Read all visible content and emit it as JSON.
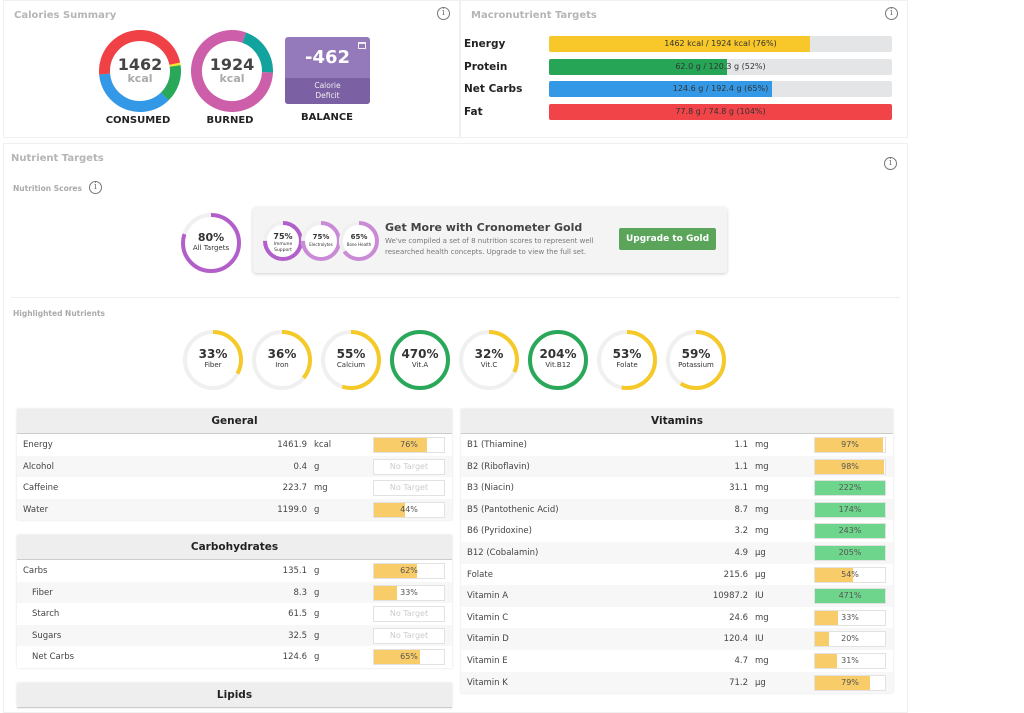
{
  "colors": {
    "yellow": "#f5c928",
    "green": "#2aa85a",
    "blue": "#3399e6",
    "red": "#ef4146",
    "purple": "#b35fc9",
    "magenta": "#cd5eaa",
    "teal": "#12a39f",
    "bar_yellow": "#f8cc68",
    "bar_green": "#6dd68c",
    "track": "#eeeeee"
  },
  "calories": {
    "title": "Calories Summary",
    "info_icon": "info-icon",
    "consumed": {
      "value": "1462",
      "unit": "kcal",
      "label": "CONSUMED",
      "segments": [
        {
          "color": "#ef4146",
          "fraction": 0.48
        },
        {
          "color": "#f5e428",
          "fraction": 0.01
        },
        {
          "color": "#2aa85a",
          "fraction": 0.15
        },
        {
          "color": "#3399e6",
          "fraction": 0.36
        }
      ]
    },
    "burned": {
      "value": "1924",
      "unit": "kcal",
      "label": "BURNED",
      "segments": [
        {
          "color": "#12a39f",
          "fraction": 0.2
        },
        {
          "color": "#cd5eaa",
          "fraction": 0.8
        }
      ]
    },
    "balance": {
      "value": "-462",
      "sub1": "Calorie",
      "sub2": "Deficit",
      "label": "BALANCE",
      "icon": "calendar-icon"
    }
  },
  "macros": {
    "title": "Macronutrient Targets",
    "items": [
      {
        "label": "Energy",
        "text": "1462 kcal / 1924 kcal (76%)",
        "percent": 76,
        "color": "#f8c72a"
      },
      {
        "label": "Protein",
        "text": "62.0 g / 120.3 g (52%)",
        "percent": 52,
        "color": "#26a556"
      },
      {
        "label": "Net Carbs",
        "text": "124.6 g / 192.4 g (65%)",
        "percent": 65,
        "color": "#3399e6"
      },
      {
        "label": "Fat",
        "text": "77.8 g / 74.8 g (104%)",
        "percent": 104,
        "color": "#f04449"
      }
    ]
  },
  "nutrient_targets": {
    "title": "Nutrient Targets",
    "scores_label": "Nutrition Scores",
    "all_targets": {
      "value": "80%",
      "label": "All Targets",
      "percent": 80
    },
    "promo": {
      "scores": [
        {
          "value": "75%",
          "label": "Immune Support",
          "percent": 75
        },
        {
          "value": "75%",
          "label": "Electrolytes",
          "percent": 75
        },
        {
          "value": "65%",
          "label": "Bone Health",
          "percent": 65
        }
      ],
      "title": "Get More with Cronometer Gold",
      "text": "We've compiled a set of 8 nutrition scores to represent well researched health concepts. Upgrade to view the full set.",
      "button": "Upgrade to Gold"
    },
    "highlighted_label": "Highlighted Nutrients",
    "highlighted": [
      {
        "value": "33%",
        "label": "Fiber",
        "percent": 33
      },
      {
        "value": "36%",
        "label": "Iron",
        "percent": 36
      },
      {
        "value": "55%",
        "label": "Calcium",
        "percent": 55
      },
      {
        "value": "470%",
        "label": "Vit.A",
        "percent": 470
      },
      {
        "value": "32%",
        "label": "Vit.C",
        "percent": 32
      },
      {
        "value": "204%",
        "label": "Vit.B12",
        "percent": 204
      },
      {
        "value": "53%",
        "label": "Folate",
        "percent": 53
      },
      {
        "value": "59%",
        "label": "Potassium",
        "percent": 59
      }
    ]
  },
  "tables": [
    {
      "title": "General",
      "rows": [
        {
          "name": "Energy",
          "amount": "1461.9",
          "unit": "kcal",
          "pct": "76%",
          "percent": 76
        },
        {
          "name": "Alcohol",
          "amount": "0.4",
          "unit": "g",
          "pct": "No Target"
        },
        {
          "name": "Caffeine",
          "amount": "223.7",
          "unit": "mg",
          "pct": "No Target"
        },
        {
          "name": "Water",
          "amount": "1199.0",
          "unit": "g",
          "pct": "44%",
          "percent": 44
        }
      ]
    },
    {
      "title": "Carbohydrates",
      "rows": [
        {
          "name": "Carbs",
          "amount": "135.1",
          "unit": "g",
          "pct": "62%",
          "percent": 62
        },
        {
          "name": "Fiber",
          "amount": "8.3",
          "unit": "g",
          "pct": "33%",
          "percent": 33,
          "indent": true
        },
        {
          "name": "Starch",
          "amount": "61.5",
          "unit": "g",
          "pct": "No Target",
          "indent": true
        },
        {
          "name": "Sugars",
          "amount": "32.5",
          "unit": "g",
          "pct": "No Target",
          "indent": true
        },
        {
          "name": "Net Carbs",
          "amount": "124.6",
          "unit": "g",
          "pct": "65%",
          "percent": 65,
          "indent": true
        }
      ]
    },
    {
      "title": "Lipids",
      "rows": []
    },
    {
      "title": "Vitamins",
      "rows": [
        {
          "name": "B1 (Thiamine)",
          "amount": "1.1",
          "unit": "mg",
          "pct": "97%",
          "percent": 97
        },
        {
          "name": "B2 (Riboflavin)",
          "amount": "1.1",
          "unit": "mg",
          "pct": "98%",
          "percent": 98
        },
        {
          "name": "B3 (Niacin)",
          "amount": "31.1",
          "unit": "mg",
          "pct": "222%",
          "percent": 222
        },
        {
          "name": "B5 (Pantothenic Acid)",
          "amount": "8.7",
          "unit": "mg",
          "pct": "174%",
          "percent": 174
        },
        {
          "name": "B6 (Pyridoxine)",
          "amount": "3.2",
          "unit": "mg",
          "pct": "243%",
          "percent": 243
        },
        {
          "name": "B12 (Cobalamin)",
          "amount": "4.9",
          "unit": "µg",
          "pct": "205%",
          "percent": 205
        },
        {
          "name": "Folate",
          "amount": "215.6",
          "unit": "µg",
          "pct": "54%",
          "percent": 54
        },
        {
          "name": "Vitamin A",
          "amount": "10987.2",
          "unit": "IU",
          "pct": "471%",
          "percent": 471
        },
        {
          "name": "Vitamin C",
          "amount": "24.6",
          "unit": "mg",
          "pct": "33%",
          "percent": 33
        },
        {
          "name": "Vitamin D",
          "amount": "120.4",
          "unit": "IU",
          "pct": "20%",
          "percent": 20
        },
        {
          "name": "Vitamin E",
          "amount": "4.7",
          "unit": "mg",
          "pct": "31%",
          "percent": 31
        },
        {
          "name": "Vitamin K",
          "amount": "71.2",
          "unit": "µg",
          "pct": "79%",
          "percent": 79
        }
      ]
    }
  ]
}
